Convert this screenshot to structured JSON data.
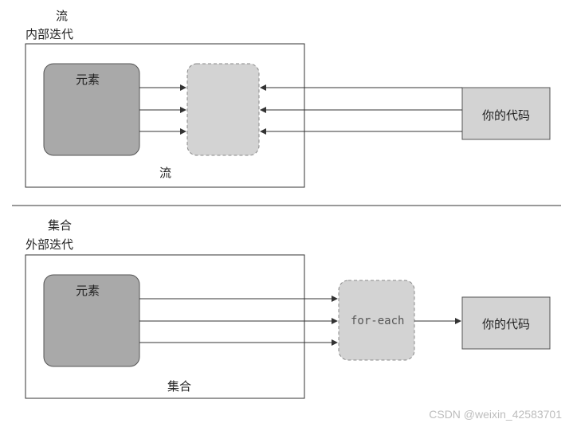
{
  "top": {
    "title": "流",
    "subtitle": "内部迭代",
    "element": "元素",
    "stream": "流",
    "code": "你的代码"
  },
  "bottom": {
    "title": "集合",
    "subtitle": "外部迭代",
    "element": "元素",
    "collection": "集合",
    "foreach": "for-each",
    "code": "你的代码"
  },
  "watermark": "CSDN @weixin_42583701"
}
